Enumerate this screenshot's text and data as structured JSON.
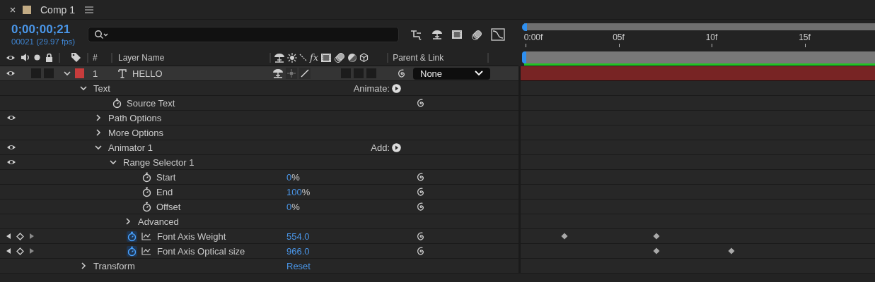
{
  "tab": {
    "title": "Comp 1",
    "color": "#c2ab84"
  },
  "time": {
    "timecode": "0;00;00;21",
    "frames": "00021 (29.97 fps)"
  },
  "columns": {
    "number": "#",
    "layer_name": "Layer Name",
    "fx": "fx",
    "parent": "Parent & Link"
  },
  "ruler": {
    "labels": [
      "0:00f",
      "05f",
      "10f",
      "15f"
    ]
  },
  "layer": {
    "number": "1",
    "name": "HELLO",
    "visible": true,
    "audio": false,
    "solo": false,
    "expanded": true,
    "color": "#c83c3c",
    "motion_blur": false,
    "adjustment": false,
    "three_d": false,
    "parent": "None"
  },
  "properties": [
    {
      "kind": "group",
      "name": "Text",
      "expanded": true,
      "visible": false,
      "action": "Animate:",
      "children": [
        {
          "kind": "property",
          "name": "Source Text",
          "visible": false,
          "animated": false,
          "pickwhip": true
        },
        {
          "kind": "group",
          "name": "Path Options",
          "expanded": false,
          "visible": true
        },
        {
          "kind": "group",
          "name": "More Options",
          "expanded": false,
          "visible": false
        },
        {
          "kind": "group",
          "name": "Animator 1",
          "expanded": true,
          "visible": true,
          "action": "Add:",
          "children": [
            {
              "kind": "group",
              "name": "Range Selector 1",
              "expanded": true,
              "visible": true,
              "children": [
                {
                  "kind": "property",
                  "name": "Start",
                  "visible": false,
                  "animated": false,
                  "value": "0",
                  "unit": "%",
                  "pickwhip": true
                },
                {
                  "kind": "property",
                  "name": "End",
                  "visible": false,
                  "animated": false,
                  "value": "100",
                  "unit": "%",
                  "pickwhip": true
                },
                {
                  "kind": "property",
                  "name": "Offset",
                  "visible": false,
                  "animated": false,
                  "value": "0",
                  "unit": "%",
                  "pickwhip": true
                },
                {
                  "kind": "group",
                  "name": "Advanced",
                  "expanded": false,
                  "visible": false
                }
              ]
            },
            {
              "kind": "property",
              "name": "Font Axis Weight",
              "visible": false,
              "animated": true,
              "value": "554.0",
              "pickwhip": true,
              "keyframes": [
                {
                  "level": 0.124
                },
                {
                  "level": 0.384
                }
              ]
            },
            {
              "kind": "property",
              "name": "Font Axis Optical size",
              "visible": false,
              "animated": true,
              "value": "966.0",
              "pickwhip": true,
              "keyframes": [
                {
                  "level": 0.384
                },
                {
                  "level": 0.594
                }
              ]
            }
          ]
        }
      ]
    },
    {
      "kind": "group",
      "name": "Transform",
      "expanded": false,
      "visible": false,
      "link": "Reset"
    }
  ]
}
